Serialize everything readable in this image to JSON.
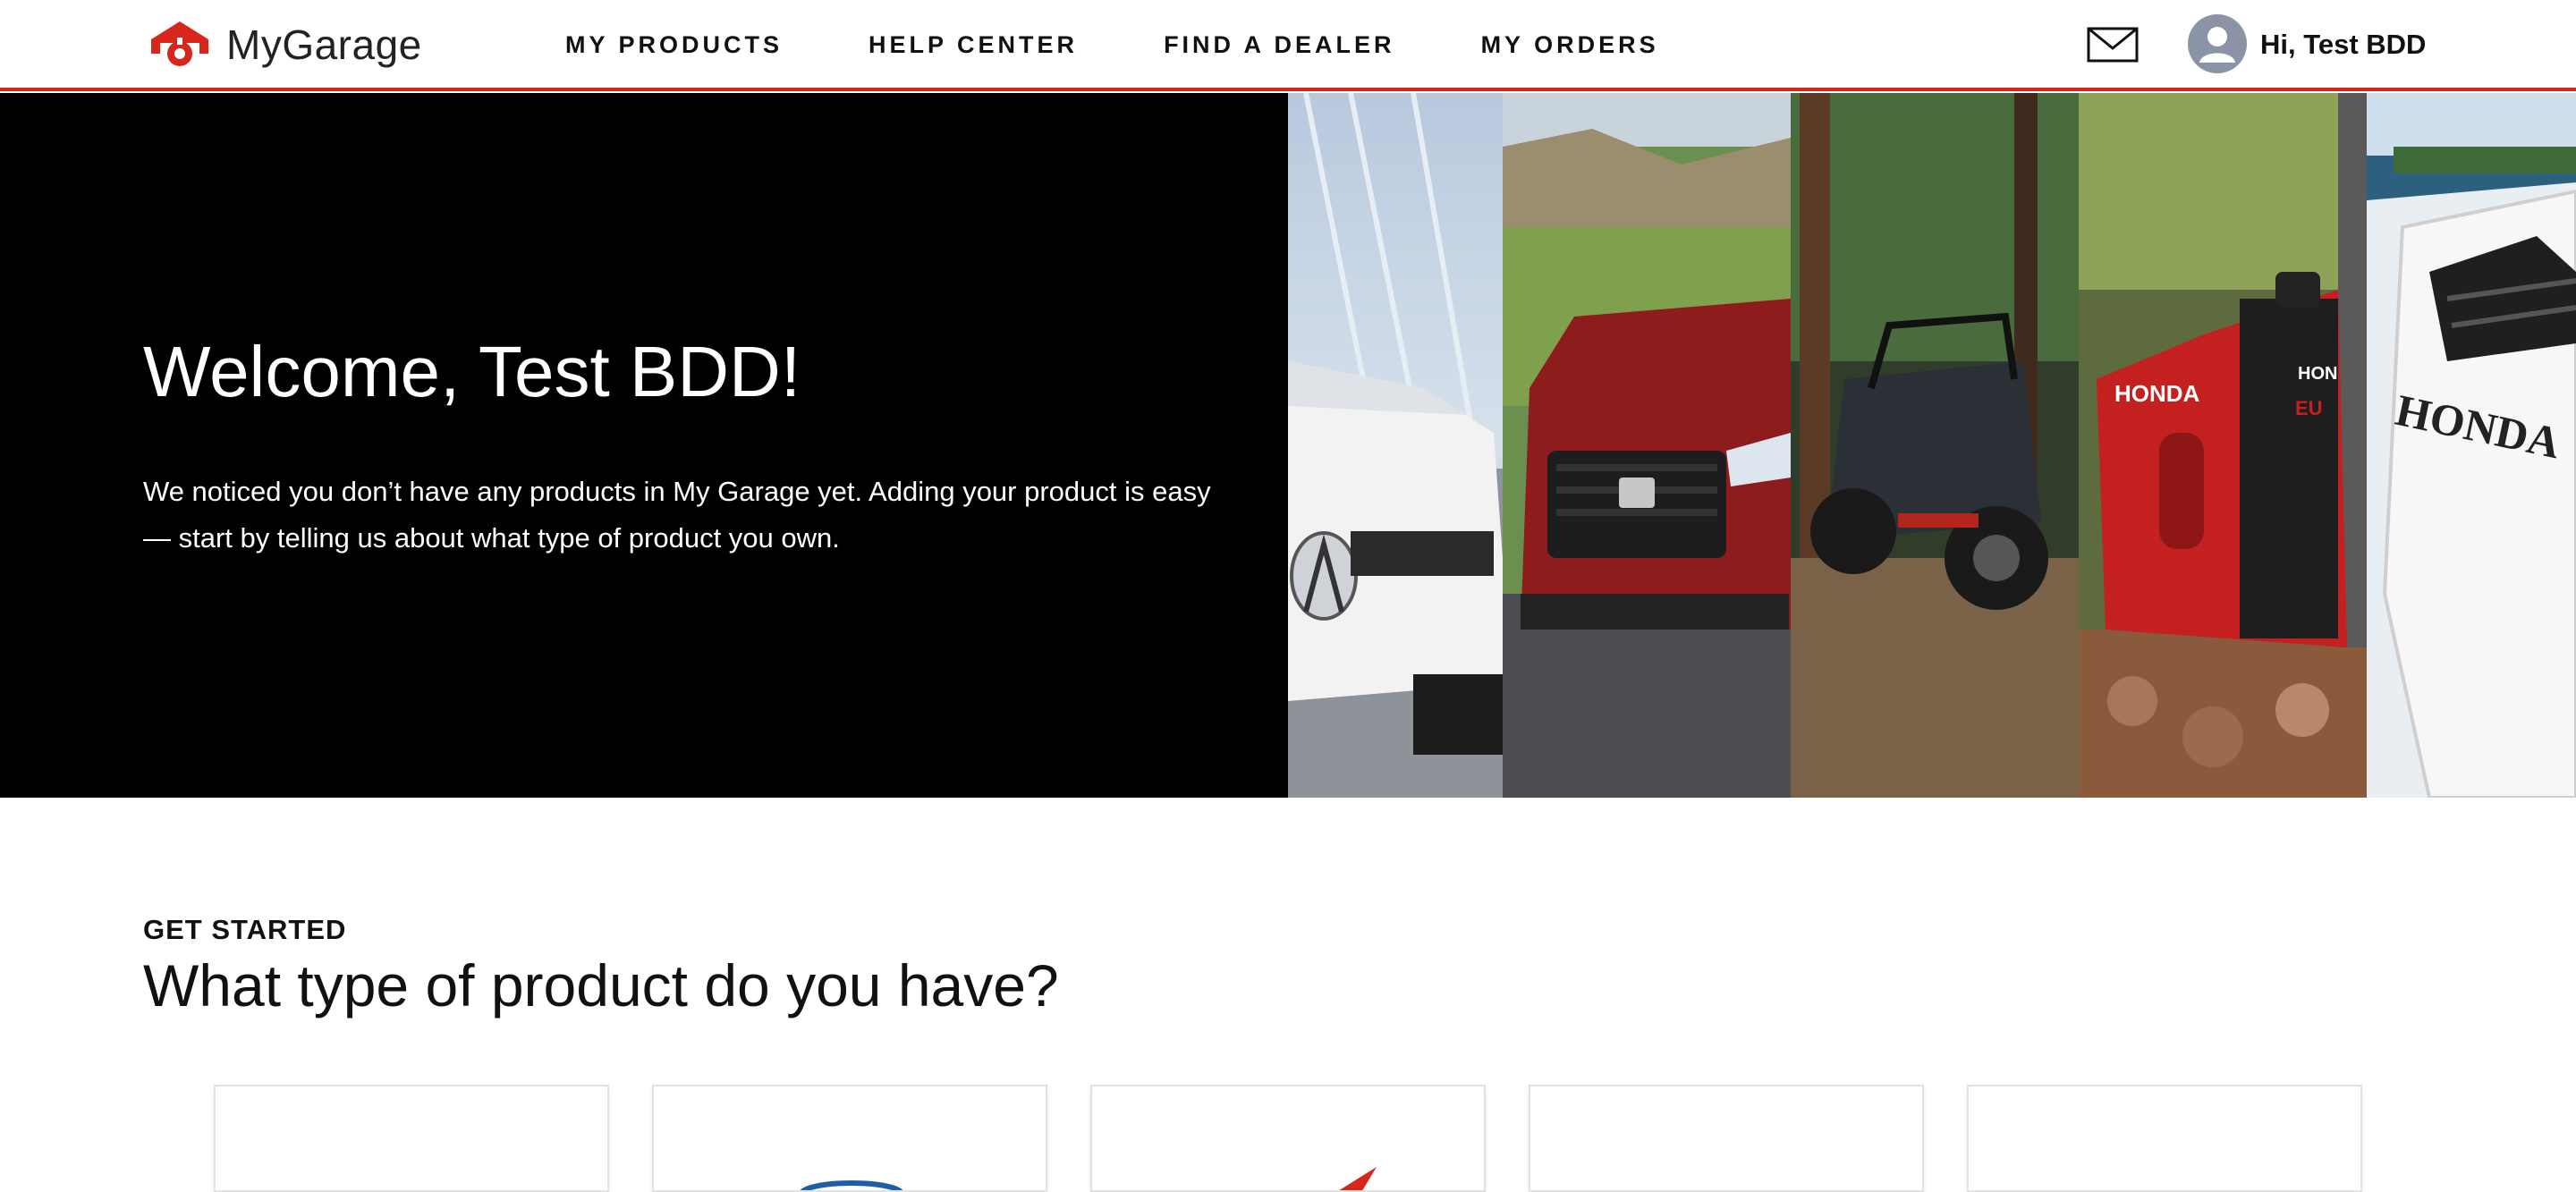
{
  "header": {
    "logo_text": "MyGarage",
    "nav": [
      "MY PRODUCTS",
      "HELP CENTER",
      "FIND A DEALER",
      "MY ORDERS"
    ],
    "mail_icon": "mail-icon",
    "avatar_icon": "user-avatar-icon",
    "greeting": "Hi, Test BDD"
  },
  "hero": {
    "title": "Welcome, Test BDD!",
    "text": "We noticed you don’t have any products in My Garage yet. Adding your product is easy — start by telling us about what type of product you own.",
    "panels": [
      "acura-sedan",
      "honda-pickup",
      "honda-side-by-side",
      "honda-generator",
      "honda-outboard-motor"
    ],
    "panel_lettering": [
      "HONDA",
      "HONDA",
      "HONDA"
    ]
  },
  "get_started": {
    "eyebrow": "GET STARTED",
    "title": "What type of product do you have?",
    "cards": [
      "product-type-card-1",
      "product-type-card-2",
      "product-type-card-3",
      "product-type-card-4",
      "product-type-card-5"
    ]
  },
  "colors": {
    "accent": "#d9261c",
    "hero_bg": "#000000",
    "text": "#111111"
  }
}
